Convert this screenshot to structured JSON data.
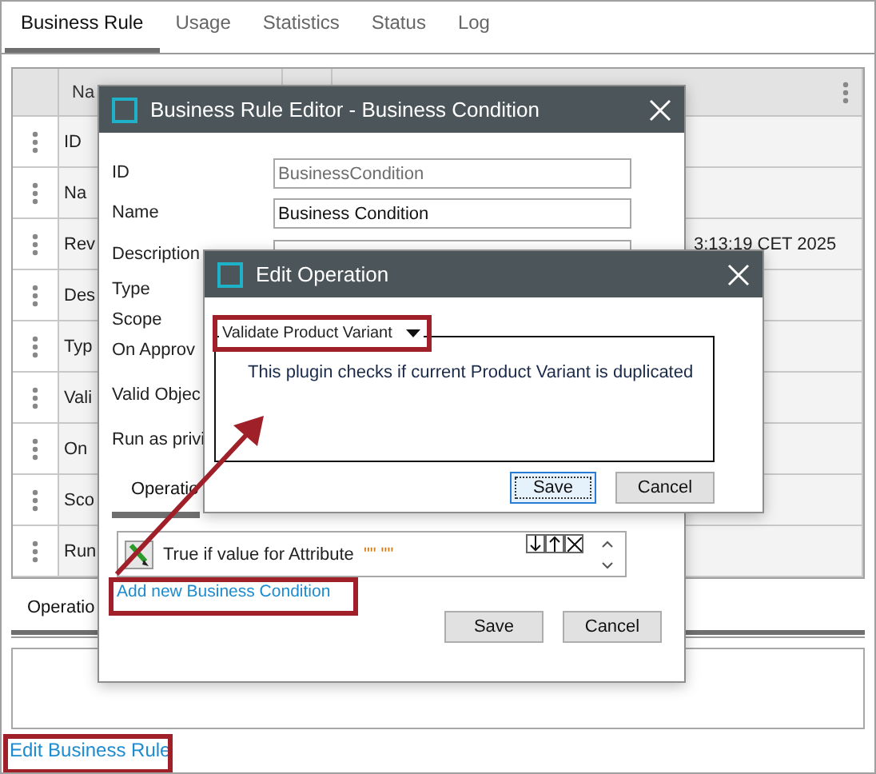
{
  "tabs": [
    {
      "label": "Business Rule",
      "selected": true
    },
    {
      "label": "Usage",
      "selected": false
    },
    {
      "label": "Statistics",
      "selected": false
    },
    {
      "label": "Status",
      "selected": false
    },
    {
      "label": "Log",
      "selected": false
    }
  ],
  "table": {
    "header": "Na",
    "rows": [
      {
        "label": "ID"
      },
      {
        "label": "Na"
      },
      {
        "label": "Rev",
        "value": "3:13:19 CET 2025"
      },
      {
        "label": "Des"
      },
      {
        "label": "Typ"
      },
      {
        "label": "Vali"
      },
      {
        "label": "On"
      },
      {
        "label": "Sco"
      },
      {
        "label": "Run"
      }
    ]
  },
  "bottom_tabs": [
    {
      "label": "Operatio",
      "selected": true
    }
  ],
  "edit_link": "Edit Business Rule",
  "editor": {
    "title": "Business Rule Editor - Business Condition",
    "fields": [
      {
        "label": "ID",
        "kind": "input",
        "value": "BusinessCondition",
        "disabled": true
      },
      {
        "label": "Name",
        "kind": "input",
        "value": "Business Condition",
        "disabled": false
      },
      {
        "label": "Description",
        "kind": "input"
      },
      {
        "label": "Type",
        "kind": "label"
      },
      {
        "label": "Scope",
        "kind": "label"
      },
      {
        "label": "On Approv",
        "kind": "label"
      },
      {
        "label": "Valid Objec",
        "kind": "label"
      },
      {
        "label": "Run as privi",
        "kind": "label"
      }
    ],
    "tab": {
      "label": "Operatio",
      "selected": true
    },
    "conditions": [
      {
        "text": "True if value for Attribute",
        "value": "\"\"  \"\""
      }
    ],
    "add_link": "Add new Business Condition",
    "buttons": [
      "Save",
      "Cancel"
    ]
  },
  "operation_dialog": {
    "title": "Edit Operation",
    "plugin": "Validate Product Variant",
    "description": "This plugin checks if current Product Variant is duplicated",
    "buttons": [
      {
        "label": "Save",
        "focused": true
      },
      {
        "label": "Cancel",
        "focused": false
      }
    ]
  }
}
